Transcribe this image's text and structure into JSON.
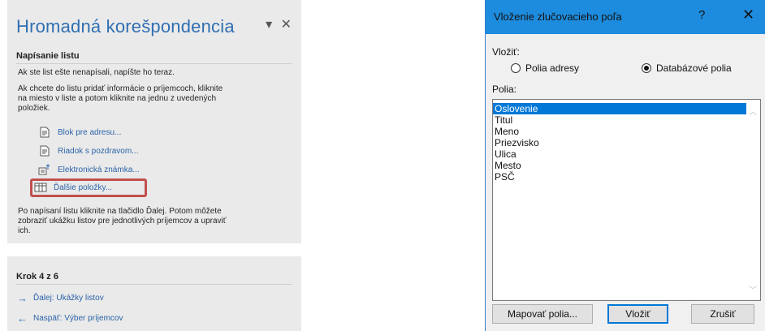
{
  "task_pane": {
    "title": "Hromadná korešpondencia",
    "section_title": "Napísanie listu",
    "intro_1": "Ak ste list ešte nenapísali, napíšte ho teraz.",
    "intro_2_line1": "Ak chcete do listu pridať informácie o príjemcoch, kliknite",
    "intro_2_line2": "na miesto v liste a potom kliknite na jednu z uvedených",
    "intro_2_line3": "položiek.",
    "links": [
      {
        "label": "Blok pre adresu...",
        "icon": "document-icon"
      },
      {
        "label": "Riadok s pozdravom...",
        "icon": "document-icon"
      },
      {
        "label": "Elektronická známka...",
        "icon": "postage-icon"
      },
      {
        "label": "Ďalšie položky...",
        "icon": "database-icon"
      }
    ],
    "outro_line1": "Po napísaní listu kliknite na tlačidlo Ďalej. Potom môžete",
    "outro_line2": "zobraziť ukážku listov pre jednotlivých príjemcov a upraviť",
    "outro_line3": "ich.",
    "step_title": "Krok 4 z 6",
    "next_label": "Ďalej: Ukážky listov",
    "back_label": "Naspäť: Výber príjemcov"
  },
  "dialog": {
    "title": "Vloženie zlučovacieho poľa",
    "help": "?",
    "close": "✕",
    "insert_label": "Vložiť:",
    "radio_address": "Polia adresy",
    "radio_database": "Databázové polia",
    "radio_selected": "database",
    "fields_label": "Polia:",
    "fields": [
      "Oslovenie",
      "Titul",
      "Meno",
      "Priezvisko",
      "Ulica",
      "Mesto",
      "PSČ"
    ],
    "selected_field": "Oslovenie",
    "btn_map": "Mapovať polia...",
    "btn_insert": "Vložiť",
    "btn_cancel": "Zrušiť"
  },
  "colors": {
    "accent": "#2f6fb2",
    "highlight_border": "#c0504d",
    "titlebar": "#1e8cde",
    "selection": "#0078d7"
  }
}
